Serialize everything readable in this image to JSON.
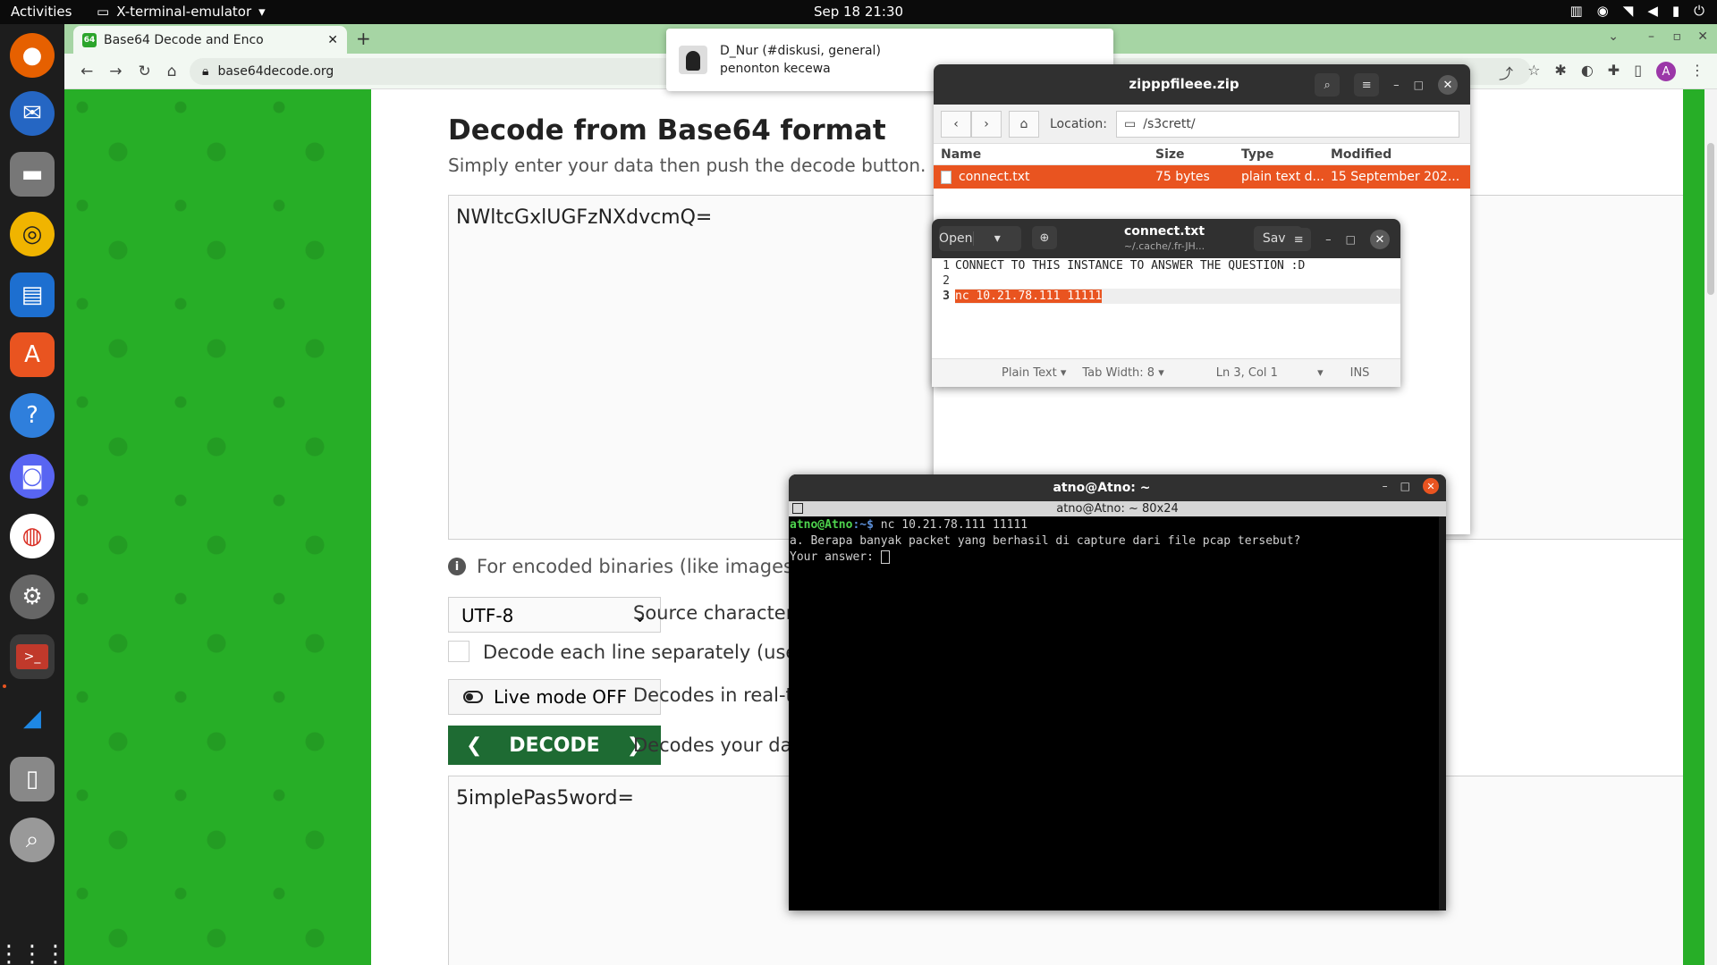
{
  "topbar": {
    "activities": "Activities",
    "app_name": "X-terminal-emulator",
    "clock": "Sep 18  21:30"
  },
  "dock": {
    "items": [
      "firefox-icon",
      "thunderbird-icon",
      "files-icon",
      "rhythmbox-icon",
      "writer-icon",
      "software-icon",
      "help-icon",
      "discord-icon",
      "chrome-icon",
      "settings-icon",
      "terminal-icon",
      "wireshark-icon",
      "zip-icon",
      "search-icon",
      "apps-grid-icon"
    ]
  },
  "browser": {
    "tab_title": "Base64 Decode and Enco",
    "url": "base64decode.org",
    "avatar_letter": "A"
  },
  "page": {
    "heading": "Decode from Base64 format",
    "subtitle": "Simply enter your data then push the decode button.",
    "input_value": "NWltcGxlUGFzNXdvcmQ=",
    "info_text": "For encoded binaries (like images, documen",
    "charset_value": "UTF-8",
    "charset_label": "Source character set.",
    "each_line_label": "Decode each line separately (useful for wher",
    "live_mode_label": "Live mode OFF",
    "live_mode_desc": "Decodes in real-time a",
    "decode_button": "DECODE",
    "decode_desc": "Decodes your data in",
    "output_value": "5implePas5word="
  },
  "notification": {
    "title": "D_Nur (#diskusi, general)",
    "body": "penonton kecewa"
  },
  "file_manager": {
    "title": "zipppfileee.zip",
    "location_label": "Location:",
    "location_path": "/s3crett/",
    "columns": [
      "Name",
      "Size",
      "Type",
      "Modified"
    ],
    "rows": [
      {
        "name": "connect.txt",
        "size": "75 bytes",
        "type": "plain text d...",
        "modified": "15 September 202..."
      }
    ]
  },
  "text_editor": {
    "open_label": "Open",
    "title": "connect.txt",
    "subtitle": "~/.cache/.fr-JH...",
    "save_label": "Save",
    "line_numbers": [
      "1",
      "2",
      "3"
    ],
    "lines": [
      "CONNECT TO THIS INSTANCE TO ANSWER THE QUESTION :D",
      "",
      "nc 10.21.78.111 11111"
    ],
    "status_lang": "Plain Text",
    "status_tab": "Tab Width: 8",
    "status_pos": "Ln 3, Col 1",
    "status_ins": "INS"
  },
  "terminal": {
    "title": "atno@Atno: ~",
    "subtitle": "atno@Atno: ~ 80x24",
    "prompt_user": "atno@Atno",
    "prompt_path": ":~$",
    "command": " nc 10.21.78.111 11111",
    "output_line": "a. Berapa banyak packet yang berhasil di capture dari file pcap tersebut?",
    "answer_prompt": "Your answer: "
  }
}
